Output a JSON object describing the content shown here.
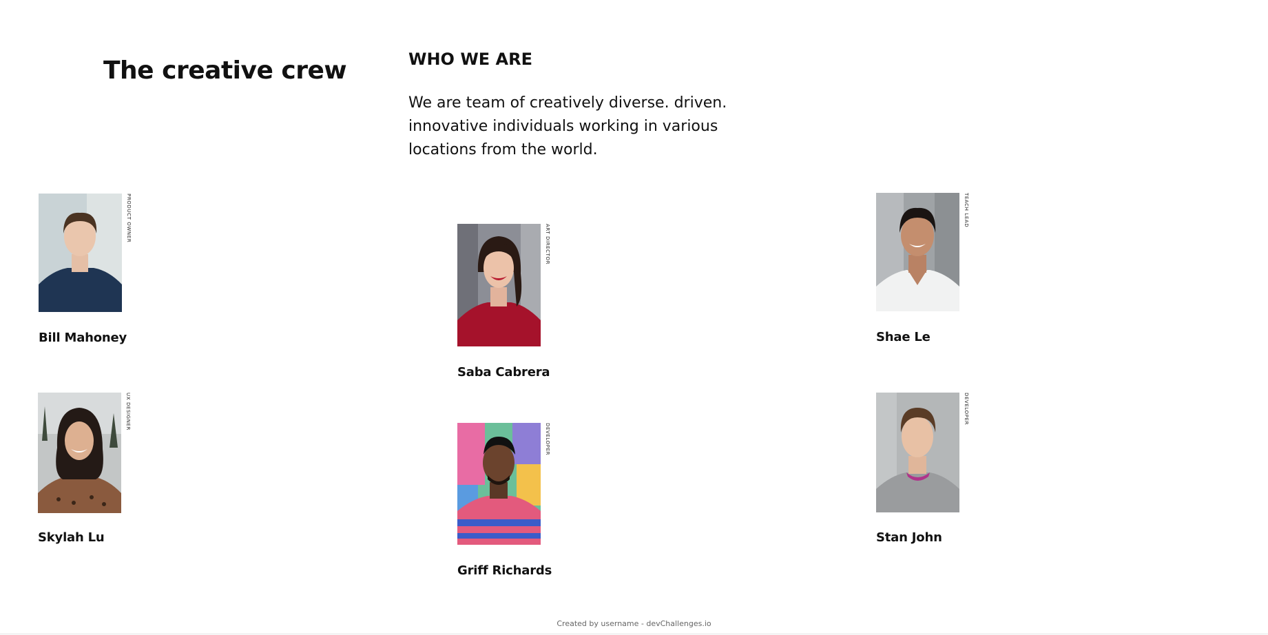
{
  "header": {
    "title": "The creative crew",
    "who_heading": "WHO WE ARE",
    "who_text": "We are team of creatively diverse. driven. innovative individuals working in various locations from the world."
  },
  "members": [
    {
      "name": "Bill Mahoney",
      "role": "PRODUCT OWNER"
    },
    {
      "name": "Saba Cabrera",
      "role": "ART DIRECTOR"
    },
    {
      "name": "Shae Le",
      "role": "TEACH LEAD"
    },
    {
      "name": "Skylah Lu",
      "role": "UX DESIGNER"
    },
    {
      "name": "Griff Richards",
      "role": "DEVELOPER"
    },
    {
      "name": "Stan John",
      "role": "DEVELOPER"
    }
  ],
  "footer": {
    "text": "Created by username - devChallenges.io"
  }
}
